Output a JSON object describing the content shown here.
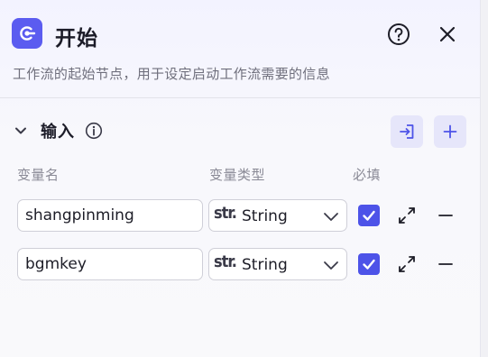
{
  "header": {
    "title": "开始",
    "description": "工作流的起始节点，用于设定启动工作流需要的信息",
    "node_icon": "start-node-icon",
    "help_icon": "help-circle-icon",
    "close_icon": "close-icon"
  },
  "input_section": {
    "title": "输入",
    "info_icon": "info-icon",
    "import_icon": "import-icon",
    "add_icon": "plus-icon",
    "columns": {
      "name": "变量名",
      "type": "变量类型",
      "required": "必填"
    },
    "rows": [
      {
        "name": "shangpinming",
        "type_prefix": "str.",
        "type": "String",
        "required": true
      },
      {
        "name": "bgmkey",
        "type_prefix": "str.",
        "type": "String",
        "required": true
      }
    ]
  },
  "colors": {
    "accent": "#4d53e8",
    "accent_light": "#e6e6fa",
    "icon_bg": "#5b5cf0"
  }
}
